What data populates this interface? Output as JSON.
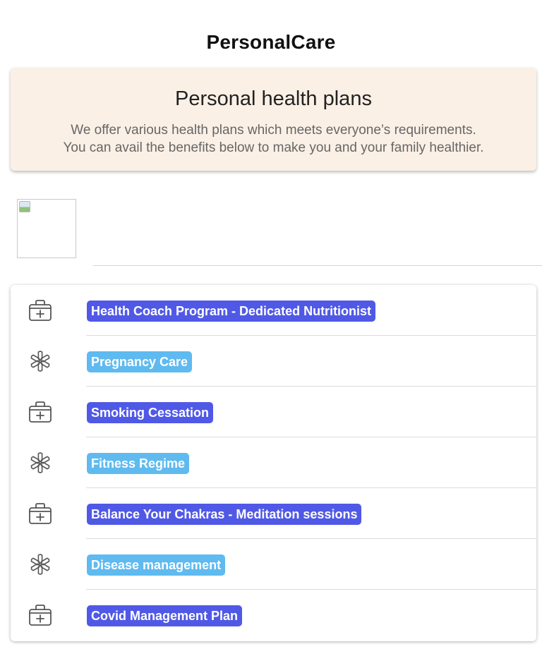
{
  "app": {
    "title": "PersonalCare"
  },
  "hero": {
    "title": "Personal health plans",
    "line1": "We offer various health plans which meets everyone’s requirements.",
    "line2": "You can avail the benefits below to make you and your family healthier."
  },
  "colors": {
    "primary_tag": "#5059e6",
    "secondary_tag": "#5fbaf0",
    "hero_bg": "#fbf0e6",
    "icon": "#555555"
  },
  "plans": [
    {
      "label": "Health Coach Program - Dedicated Nutritionist",
      "icon": "medical-kit-icon",
      "style": "primary"
    },
    {
      "label": "Pregnancy Care",
      "icon": "asterisk-icon",
      "style": "secondary"
    },
    {
      "label": "Smoking Cessation",
      "icon": "medical-kit-icon",
      "style": "primary"
    },
    {
      "label": "Fitness Regime",
      "icon": "asterisk-icon",
      "style": "secondary"
    },
    {
      "label": "Balance Your Chakras - Meditation sessions",
      "icon": "medical-kit-icon",
      "style": "primary"
    },
    {
      "label": "Disease management",
      "icon": "asterisk-icon",
      "style": "secondary"
    },
    {
      "label": "Covid Management Plan",
      "icon": "medical-kit-icon",
      "style": "primary"
    }
  ]
}
